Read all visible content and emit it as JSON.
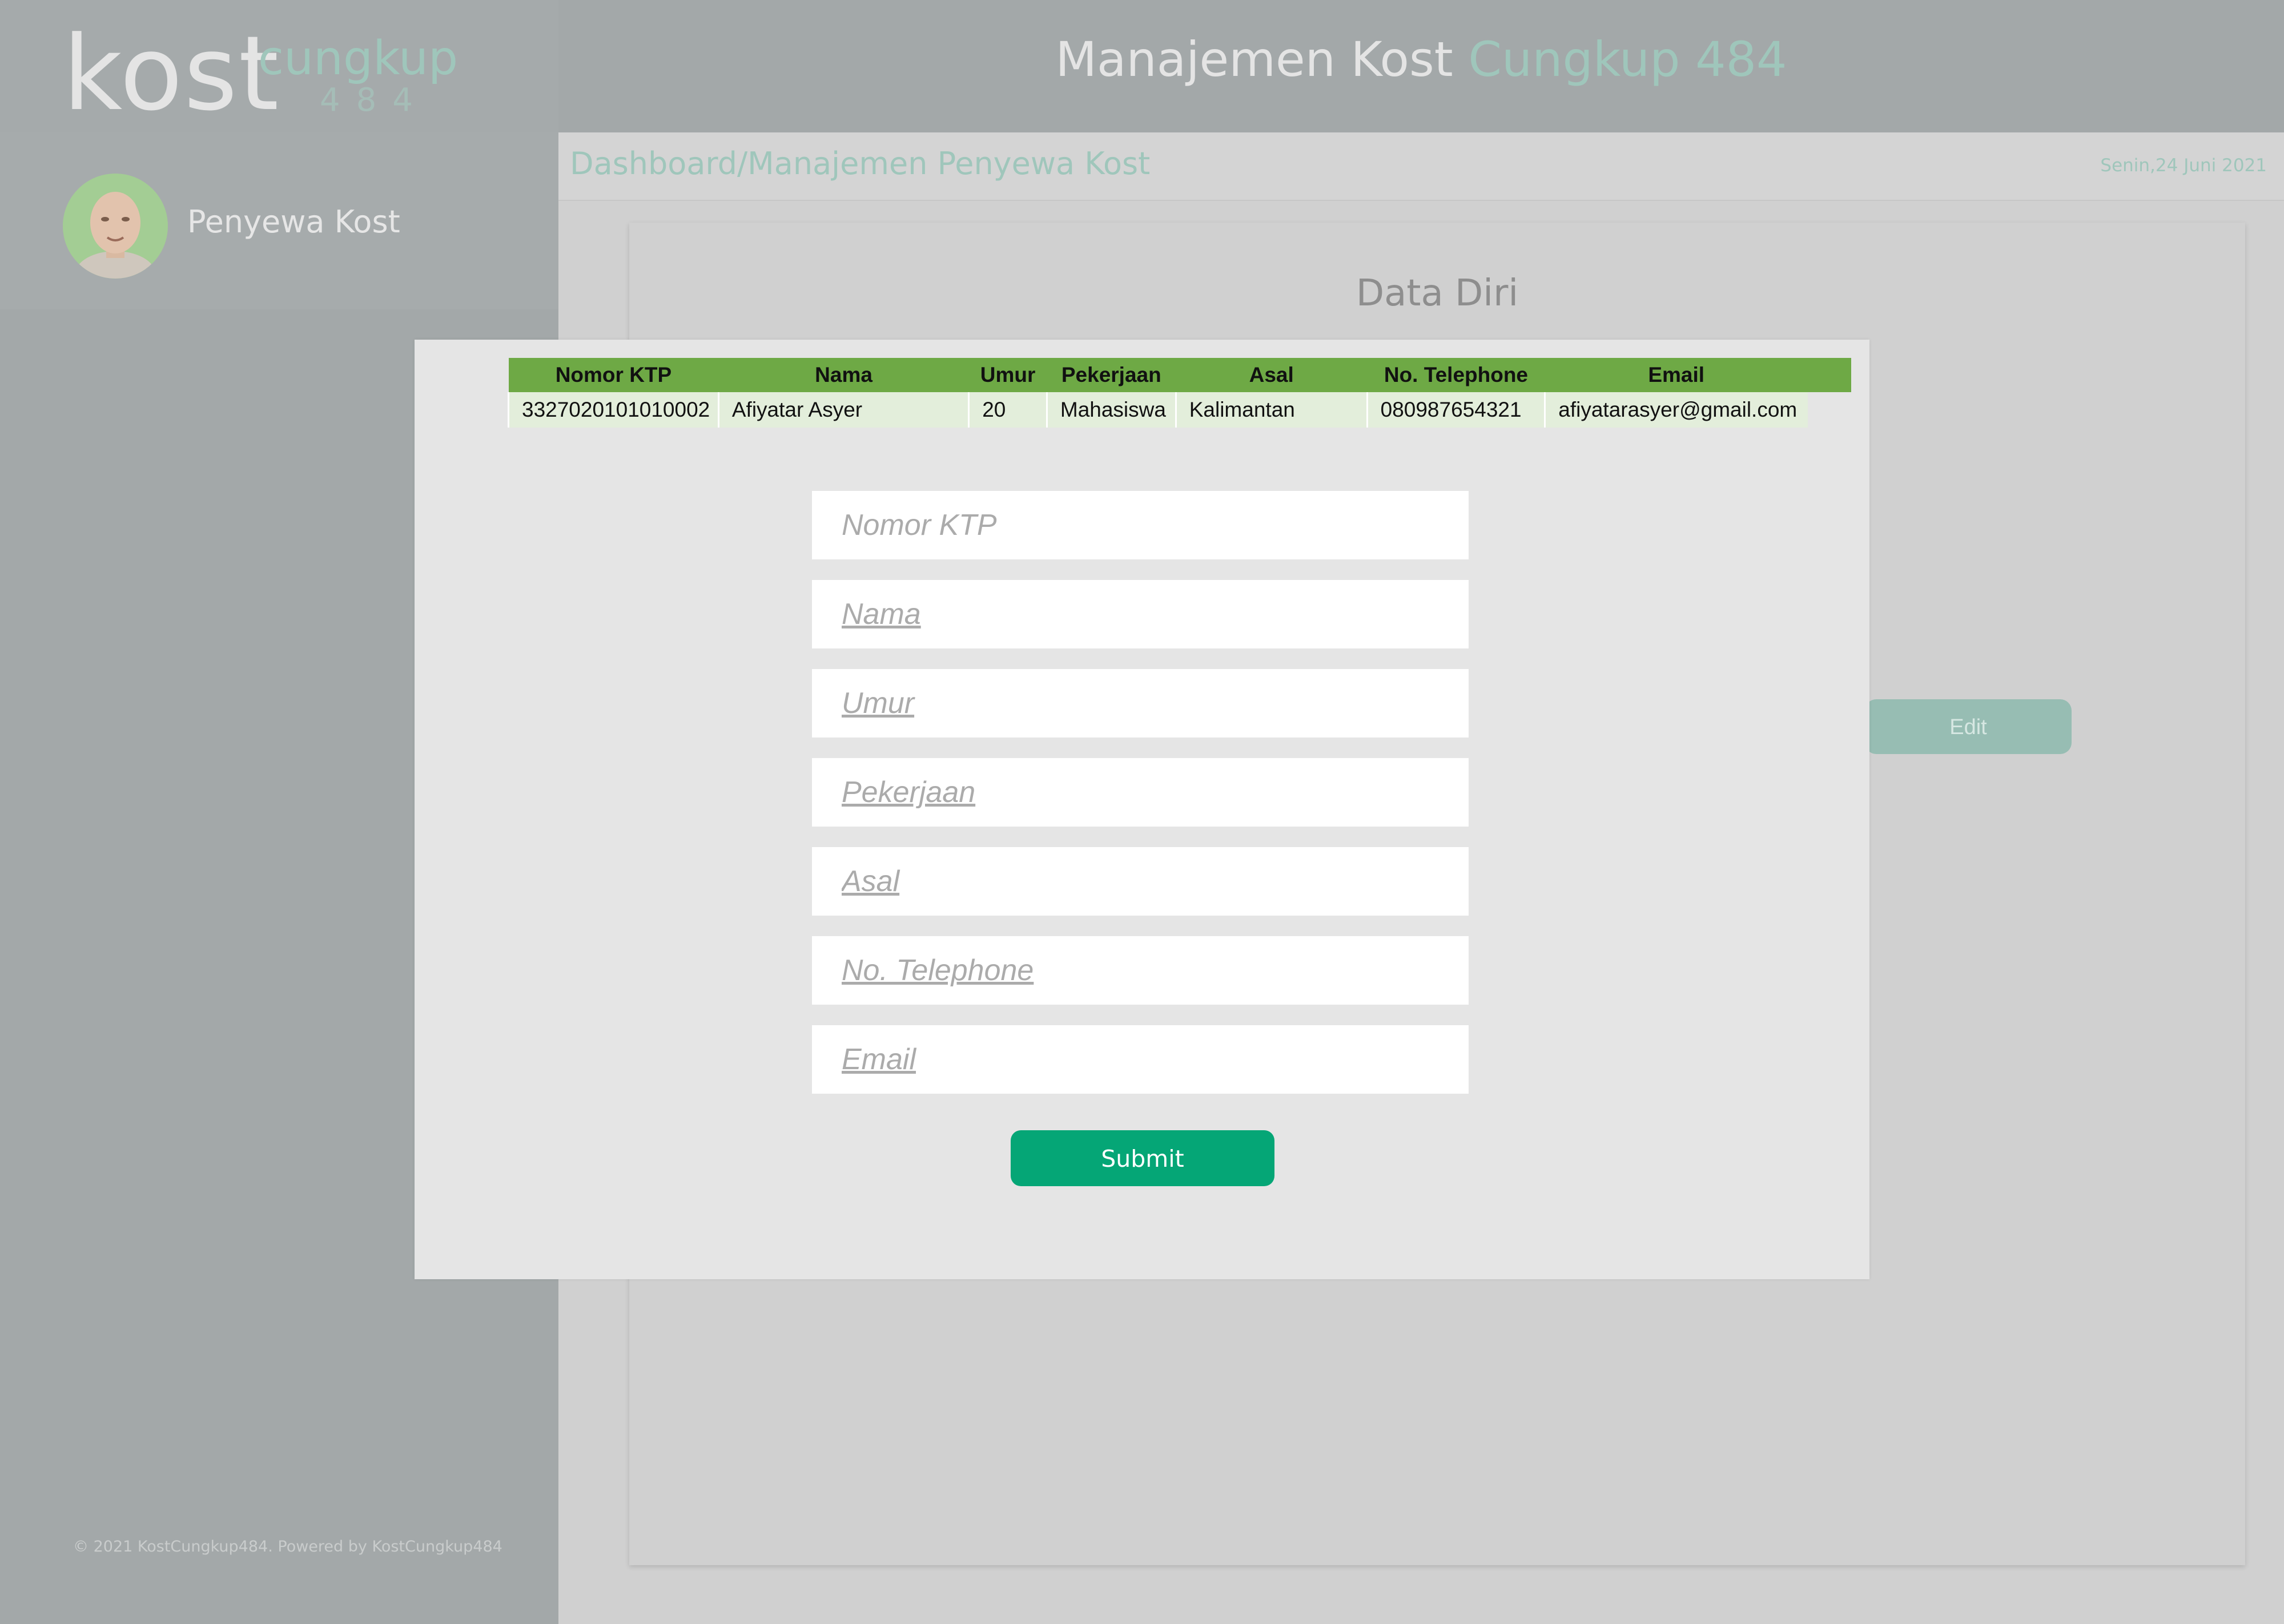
{
  "brand": {
    "kost": "kost",
    "cungkup": "cungkup",
    "number": "484"
  },
  "header": {
    "title_main": "Manajemen Kost",
    "title_accent": "Cungkup 484"
  },
  "sidebar": {
    "profile_name": "Penyewa Kost",
    "footer": "© 2021 KostCungkup484. Powered by KostCungkup484"
  },
  "breadcrumb": {
    "path": "Dashboard/Manajemen Penyewa Kost",
    "date": "Senin,24 Juni 2021"
  },
  "card": {
    "title": "Data Diri",
    "edit_label": "Edit"
  },
  "table": {
    "headers": [
      "Nomor KTP",
      "Nama",
      "Umur",
      "Pekerjaan",
      "Asal",
      "No. Telephone",
      "Email"
    ],
    "row": [
      "3327020101010002",
      "Afiyatar Asyer",
      "20",
      "Mahasiswa",
      "Kalimantan",
      "080987654321",
      "afiyatarasyer@gmail.com"
    ]
  },
  "form": {
    "fields": [
      {
        "placeholder": "Nomor KTP",
        "value": ""
      },
      {
        "placeholder": "Nama",
        "value": ""
      },
      {
        "placeholder": "Umur",
        "value": ""
      },
      {
        "placeholder": "Pekerjaan",
        "value": ""
      },
      {
        "placeholder": "Asal",
        "value": ""
      },
      {
        "placeholder": "No. Telephone",
        "value": ""
      },
      {
        "placeholder": "Email",
        "value": ""
      }
    ],
    "submit_label": "Submit"
  },
  "colors": {
    "accent": "#9fc6bb",
    "submit": "#05a676",
    "table_header": "#6ea945",
    "table_row": "#e3eedb"
  },
  "icons": {
    "avatar": "user-photo"
  }
}
